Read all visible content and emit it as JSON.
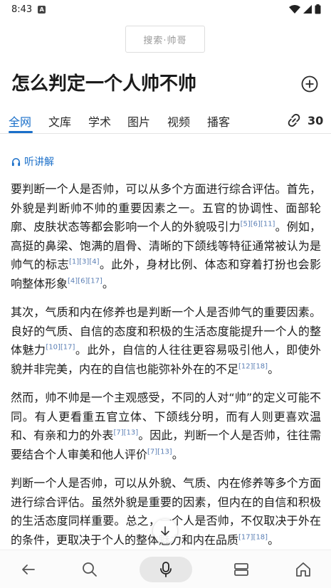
{
  "status_bar": {
    "time": "8:43",
    "notif_letter": "A"
  },
  "logo": {
    "text": "搜索·帅哥"
  },
  "title": "怎么判定一个人帅不帅",
  "tabs": [
    {
      "label": "全网"
    },
    {
      "label": "文库"
    },
    {
      "label": "学术"
    },
    {
      "label": "图片"
    },
    {
      "label": "视频"
    },
    {
      "label": "播客"
    }
  ],
  "links": {
    "count": "30"
  },
  "listen": {
    "label": "听讲解"
  },
  "paragraphs": [
    {
      "segments": [
        {
          "t": "要判断一个人是否帅，可以从多个方面进行综合评估。首先，外貌是判断帅不帅的重要因素之一。五官的协调性、面部轮廓、皮肤状态等都会影响一个人的外貌吸引力"
        },
        {
          "c": "[5][6][11]"
        },
        {
          "t": "。例如，高挺的鼻梁、饱满的眉骨、清晰的下颌线等特征通常被认为是帅气的标志"
        },
        {
          "c": "[1][3][4]"
        },
        {
          "t": "。此外，身材比例、体态和穿着打扮也会影响整体形象"
        },
        {
          "c": "[4][6][17]"
        },
        {
          "t": "。"
        }
      ]
    },
    {
      "segments": [
        {
          "t": "其次，气质和内在修养也是判断一个人是否帅气的重要因素。良好的气质、自信的态度和积极的生活态度能提升一个人的整体魅力"
        },
        {
          "c": "[10][17]"
        },
        {
          "t": "。此外，自信的人往往更容易吸引他人，即使外貌并非完美，内在的自信也能弥补外在的不足"
        },
        {
          "c": "[12][18]"
        },
        {
          "t": "。"
        }
      ]
    },
    {
      "segments": [
        {
          "t": "然而，帅不帅是一个主观感受，不同的人对“帅”的定义可能不同。有人更看重五官立体、下颌线分明，而有人则更喜欢温和、有亲和力的外表"
        },
        {
          "c": "[7][13]"
        },
        {
          "t": "。因此，判断一个人是否帅，往往需要结合个人审美和他人评价"
        },
        {
          "c": "[7][13]"
        },
        {
          "t": "。"
        }
      ]
    },
    {
      "segments": [
        {
          "t": "判断一个人是否帅，可以从外貌、气质、内在修养等多个方面进行综合评估。虽然外貌是重要的因素，但内在的自信和积极的生活态度同样重要。总之，一个人是否帅，不仅取决于外在的条件，更取决于个人的整体魅力和内在品质"
        },
        {
          "c": "[17][18]"
        },
        {
          "t": "。"
        }
      ]
    }
  ],
  "colors": {
    "accent": "#1a6fc9",
    "text": "#1b1b1b",
    "citation": "#5b7fb5"
  }
}
